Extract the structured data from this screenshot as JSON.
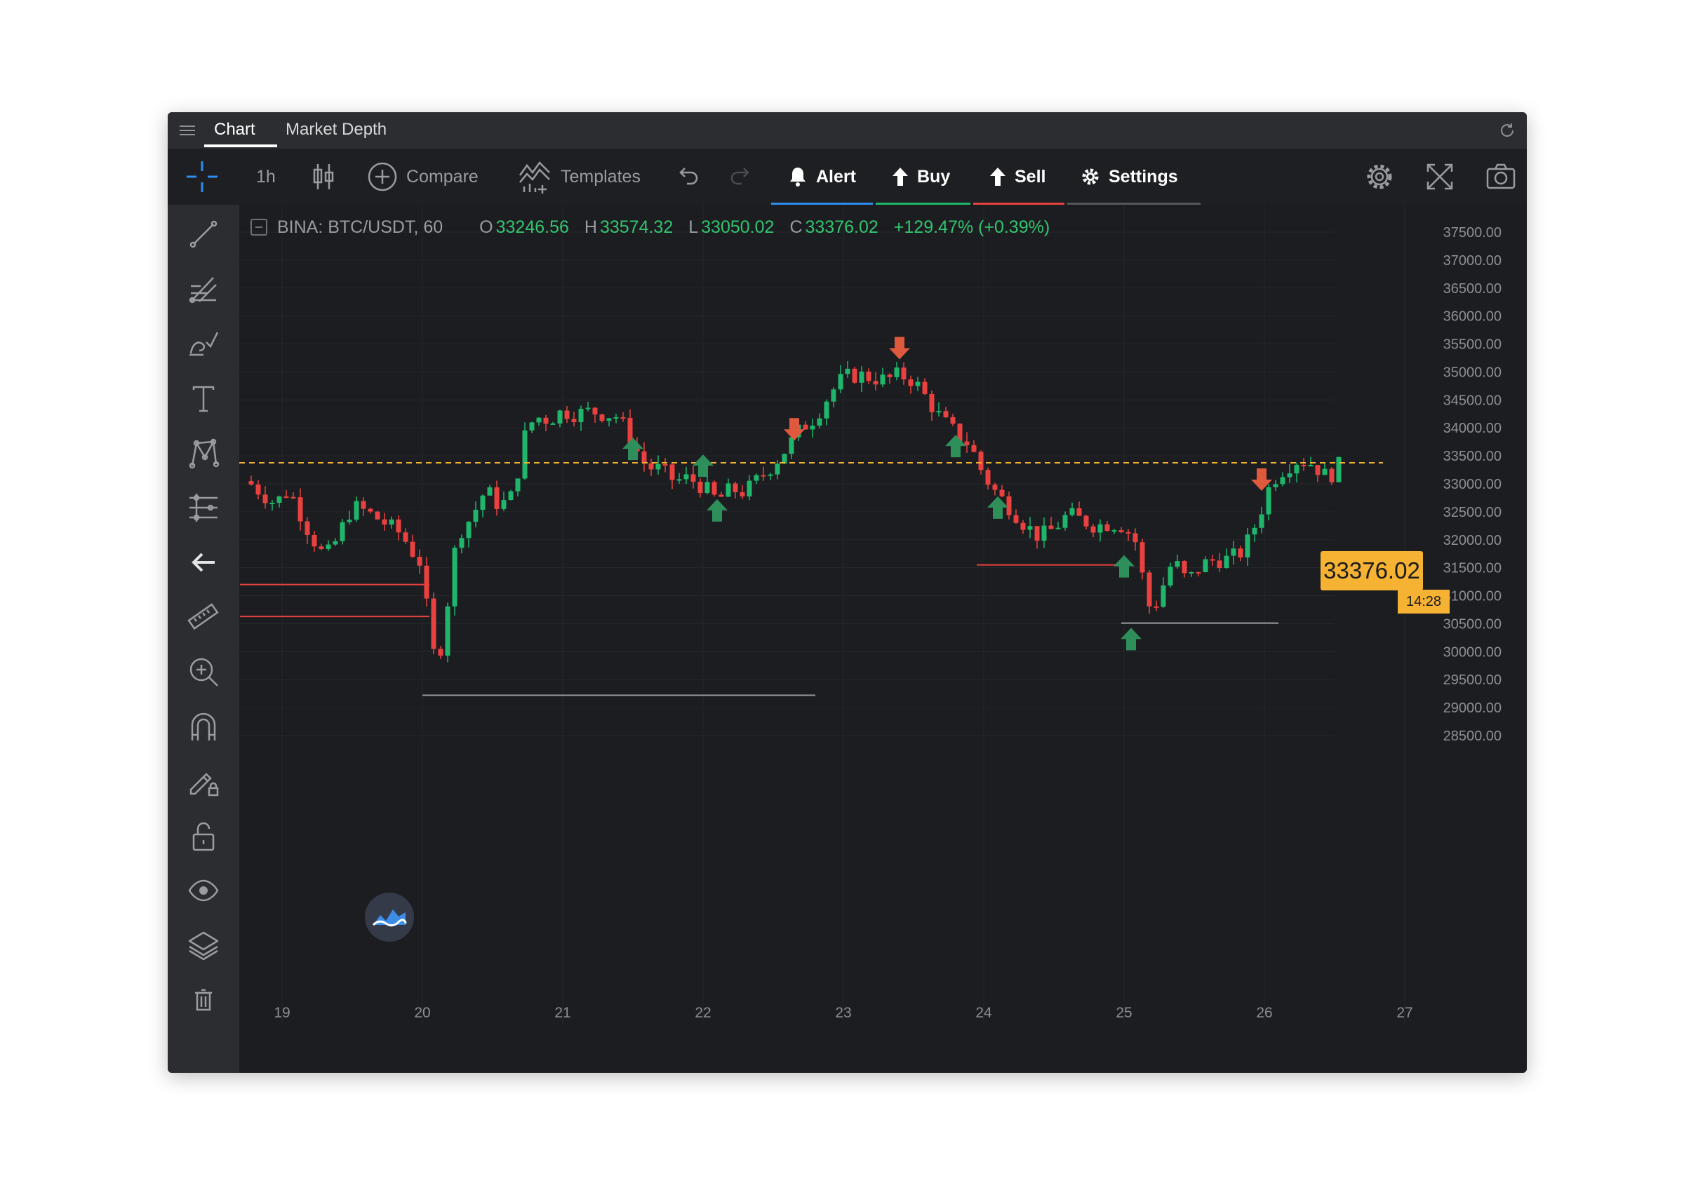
{
  "tabs": [
    {
      "label": "Chart",
      "active": true
    },
    {
      "label": "Market Depth",
      "active": false
    }
  ],
  "toolbar": {
    "interval": "1h",
    "compare_label": "Compare",
    "templates_label": "Templates",
    "alert_label": "Alert",
    "buy_label": "Buy",
    "sell_label": "Sell",
    "settings_label": "Settings",
    "icons": [
      "crosshair-icon",
      "candles-icon",
      "plus-circle-icon",
      "templates-icon",
      "undo-icon",
      "redo-icon",
      "bell-icon",
      "arrow-up-icon",
      "gear-icon",
      "settings-gear-icon",
      "fullscreen-icon",
      "camera-icon"
    ]
  },
  "left_tools": [
    "trend-line-icon",
    "fib-tool-icon",
    "brush-icon",
    "text-icon",
    "pattern-icon",
    "measure-lines-icon",
    "arrow-left-icon",
    "ruler-icon",
    "zoom-in-icon",
    "magnet-icon",
    "lock-draw-icon",
    "unlock-icon",
    "eye-icon",
    "layers-icon",
    "trash-icon"
  ],
  "legend": {
    "symbol": "BINA: BTC/USDT, 60",
    "o_label": "O",
    "o_value": "33246.56",
    "h_label": "H",
    "h_value": "33574.32",
    "l_label": "L",
    "l_value": "33050.02",
    "c_label": "C",
    "c_value": "33376.02",
    "change": "+129.47% (+0.39%)"
  },
  "last_price": "33376.02",
  "countdown": "14:28",
  "colors": {
    "up": "#1fb56b",
    "down": "#e9413f",
    "last_price": "#f6b233",
    "background": "#1c1d20"
  },
  "chart_data": {
    "type": "candlestick",
    "symbol": "BINA: BTC/USDT, 60",
    "y_ticks": [
      "37500.00",
      "37000.00",
      "36500.00",
      "36000.00",
      "35500.00",
      "35000.00",
      "34500.00",
      "34000.00",
      "33500.00",
      "33000.00",
      "32500.00",
      "32000.00",
      "31500.00",
      "31000.00",
      "30500.00",
      "30000.00",
      "29500.00",
      "29000.00",
      "28500.00"
    ],
    "x_ticks": [
      "19",
      "20",
      "21",
      "22",
      "23",
      "24",
      "25",
      "26",
      "27"
    ],
    "ylim": [
      28200,
      37700
    ],
    "xlim": [
      18.7,
      27.0
    ],
    "last_price": 33376.02,
    "close_path": [
      [
        18.75,
        33050
      ],
      [
        18.95,
        32650
      ],
      [
        19.05,
        32900
      ],
      [
        19.2,
        32100
      ],
      [
        19.3,
        31700
      ],
      [
        19.35,
        31800
      ],
      [
        19.5,
        32600
      ],
      [
        19.6,
        32500
      ],
      [
        19.7,
        32350
      ],
      [
        19.85,
        32100
      ],
      [
        19.95,
        31700
      ],
      [
        20.0,
        31550
      ],
      [
        20.05,
        30300
      ],
      [
        20.1,
        29750
      ],
      [
        20.15,
        30300
      ],
      [
        20.2,
        31300
      ],
      [
        20.25,
        32100
      ],
      [
        20.35,
        32400
      ],
      [
        20.45,
        32900
      ],
      [
        20.55,
        32600
      ],
      [
        20.65,
        32800
      ],
      [
        20.72,
        33800
      ],
      [
        20.8,
        34200
      ],
      [
        20.9,
        34150
      ],
      [
        21.0,
        34300
      ],
      [
        21.1,
        34250
      ],
      [
        21.2,
        34300
      ],
      [
        21.3,
        34250
      ],
      [
        21.4,
        34200
      ],
      [
        21.5,
        33700
      ],
      [
        21.6,
        33300
      ],
      [
        21.7,
        33250
      ],
      [
        21.8,
        33050
      ],
      [
        21.9,
        33100
      ],
      [
        22.0,
        32950
      ],
      [
        22.1,
        32700
      ],
      [
        22.2,
        32900
      ],
      [
        22.3,
        32850
      ],
      [
        22.4,
        33100
      ],
      [
        22.5,
        33350
      ],
      [
        22.6,
        33650
      ],
      [
        22.7,
        34000
      ],
      [
        22.8,
        34200
      ],
      [
        22.9,
        34600
      ],
      [
        23.0,
        34900
      ],
      [
        23.1,
        34950
      ],
      [
        23.2,
        34900
      ],
      [
        23.3,
        34850
      ],
      [
        23.4,
        34950
      ],
      [
        23.5,
        34850
      ],
      [
        23.6,
        34500
      ],
      [
        23.7,
        34150
      ],
      [
        23.8,
        33900
      ],
      [
        23.9,
        33700
      ],
      [
        24.0,
        33150
      ],
      [
        24.1,
        32800
      ],
      [
        24.2,
        32550
      ],
      [
        24.3,
        32250
      ],
      [
        24.4,
        32050
      ],
      [
        24.5,
        32200
      ],
      [
        24.6,
        32450
      ],
      [
        24.7,
        32350
      ],
      [
        24.8,
        32250
      ],
      [
        24.9,
        32300
      ],
      [
        25.0,
        32250
      ],
      [
        25.1,
        31900
      ],
      [
        25.15,
        31000
      ],
      [
        25.2,
        30700
      ],
      [
        25.25,
        31000
      ],
      [
        25.35,
        31650
      ],
      [
        25.45,
        31250
      ],
      [
        25.55,
        31550
      ],
      [
        25.65,
        31650
      ],
      [
        25.75,
        31650
      ],
      [
        25.85,
        31800
      ],
      [
        25.95,
        32350
      ],
      [
        26.05,
        33050
      ],
      [
        26.15,
        33300
      ],
      [
        26.25,
        33450
      ],
      [
        26.35,
        33350
      ],
      [
        26.45,
        33100
      ],
      [
        26.55,
        33376
      ]
    ],
    "markers": [
      {
        "x": 21.5,
        "price": 33650,
        "dir": "up"
      },
      {
        "x": 22.0,
        "price": 33350,
        "dir": "up"
      },
      {
        "x": 22.1,
        "price": 32550,
        "dir": "up"
      },
      {
        "x": 22.65,
        "price": 33950,
        "dir": "down"
      },
      {
        "x": 23.4,
        "price": 35400,
        "dir": "down"
      },
      {
        "x": 23.8,
        "price": 33700,
        "dir": "up"
      },
      {
        "x": 24.1,
        "price": 32600,
        "dir": "up"
      },
      {
        "x": 25.0,
        "price": 31550,
        "dir": "up"
      },
      {
        "x": 25.05,
        "price": 30250,
        "dir": "up"
      },
      {
        "x": 25.98,
        "price": 33050,
        "dir": "down"
      }
    ],
    "hlines": [
      {
        "x0": 18.7,
        "x1": 20.05,
        "price": 31200,
        "color": "#e9413f"
      },
      {
        "x0": 18.7,
        "x1": 20.05,
        "price": 30630,
        "color": "#e9413f"
      },
      {
        "x0": 20.0,
        "x1": 22.8,
        "price": 29220,
        "color": "#9a9ca2"
      },
      {
        "x0": 23.95,
        "x1": 25.0,
        "price": 31550,
        "color": "#e9413f"
      },
      {
        "x0": 24.98,
        "x1": 26.1,
        "price": 30510,
        "color": "#9a9ca2"
      }
    ]
  }
}
